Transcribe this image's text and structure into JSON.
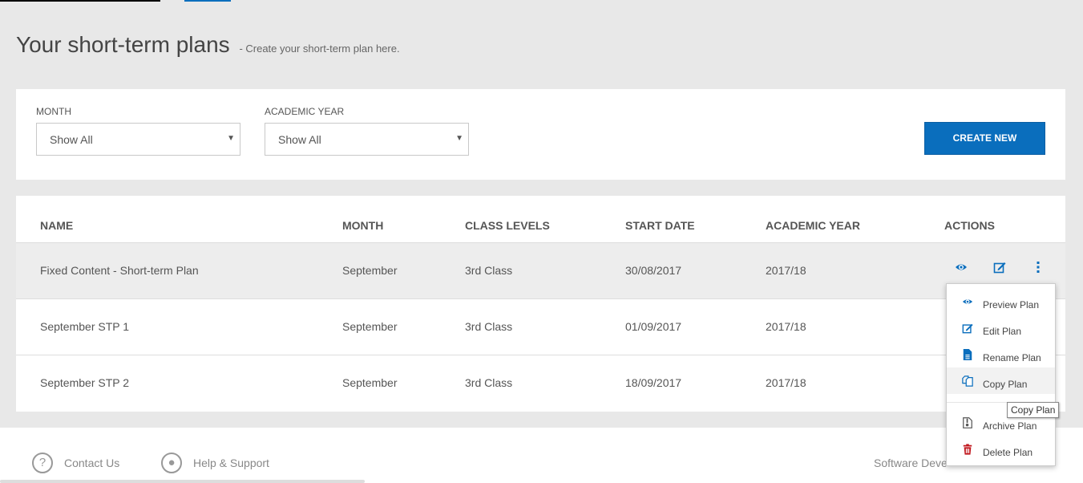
{
  "header": {
    "title": "Your short-term plans",
    "subtitle": "- Create your short-term plan here."
  },
  "filters": {
    "month": {
      "label": "MONTH",
      "value": "Show All"
    },
    "academic_year": {
      "label": "ACADEMIC YEAR",
      "value": "Show All"
    },
    "create_label": "CREATE NEW"
  },
  "table": {
    "columns": [
      "NAME",
      "MONTH",
      "CLASS LEVELS",
      "START DATE",
      "ACADEMIC YEAR",
      "ACTIONS"
    ],
    "rows": [
      {
        "name": "Fixed Content - Short-term Plan",
        "month": "September",
        "class": "3rd Class",
        "start": "30/08/2017",
        "year": "2017/18"
      },
      {
        "name": "September STP 1",
        "month": "September",
        "class": "3rd Class",
        "start": "01/09/2017",
        "year": "2017/18"
      },
      {
        "name": "September STP 2",
        "month": "September",
        "class": "3rd Class",
        "start": "18/09/2017",
        "year": "2017/18"
      }
    ]
  },
  "action_menu": {
    "items": [
      {
        "label": "Preview Plan",
        "icon": "eye-icon"
      },
      {
        "label": "Edit Plan",
        "icon": "edit-icon"
      },
      {
        "label": "Rename Plan",
        "icon": "document-icon"
      },
      {
        "label": "Copy Plan",
        "icon": "copy-icon"
      },
      {
        "label": "Archive Plan",
        "icon": "archive-icon"
      },
      {
        "label": "Delete Plan",
        "icon": "trash-icon"
      }
    ],
    "tooltip": "Copy Plan"
  },
  "footer": {
    "contact": "Contact Us",
    "help": "Help & Support",
    "software": "Software Deve"
  },
  "colors": {
    "accent": "#0a6ebd",
    "danger": "#c0161c"
  }
}
